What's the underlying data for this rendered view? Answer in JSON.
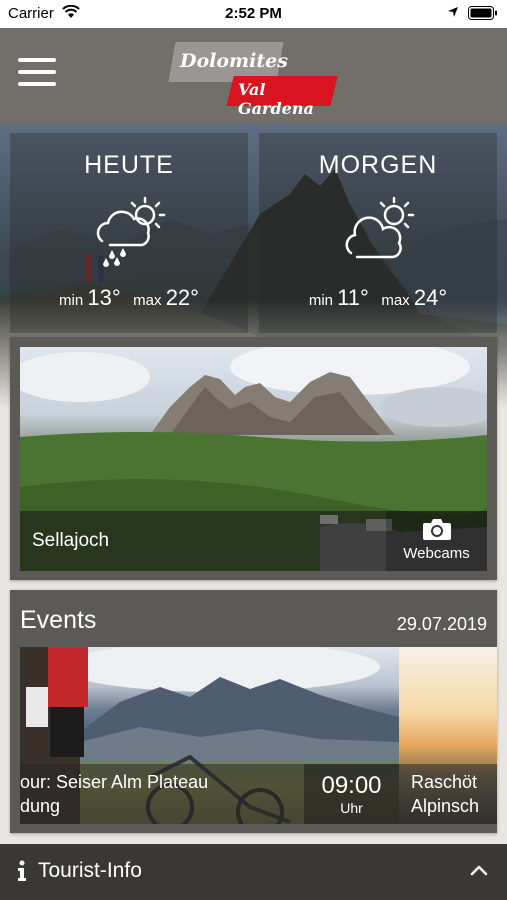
{
  "status_bar": {
    "carrier": "Carrier",
    "time": "2:52 PM"
  },
  "header": {
    "menu_icon": "hamburger-menu-icon",
    "logo": {
      "line1": "Dolomites",
      "line2": "Val Gardena",
      "brand_red": "#d7141f"
    }
  },
  "weather": [
    {
      "day": "HEUTE",
      "icon": "partly-cloudy-rain-icon",
      "min_label": "min",
      "min": "13°",
      "max_label": "max",
      "max": "22°"
    },
    {
      "day": "MORGEN",
      "icon": "partly-cloudy-icon",
      "min_label": "min",
      "min": "11°",
      "max_label": "max",
      "max": "24°"
    }
  ],
  "webcam": {
    "location": "Sellajoch",
    "button_label": "Webcams",
    "icon": "camera-icon"
  },
  "events": {
    "title": "Events",
    "date": "29.07.2019",
    "items": [
      {
        "title_line1": "our: Seiser Alm Plateau",
        "title_line2": "dung",
        "time": "09:00",
        "time_unit": "Uhr"
      },
      {
        "title_line1": "Raschöt",
        "title_line2": "Alpinsch"
      }
    ]
  },
  "bottom_bar": {
    "label": "Tourist-Info",
    "icon": "info-icon",
    "toggle_icon": "chevron-up-icon"
  },
  "colors": {
    "header": "#726e6a",
    "card": "#5c5a57",
    "bottom_bar": "#3a3836"
  }
}
